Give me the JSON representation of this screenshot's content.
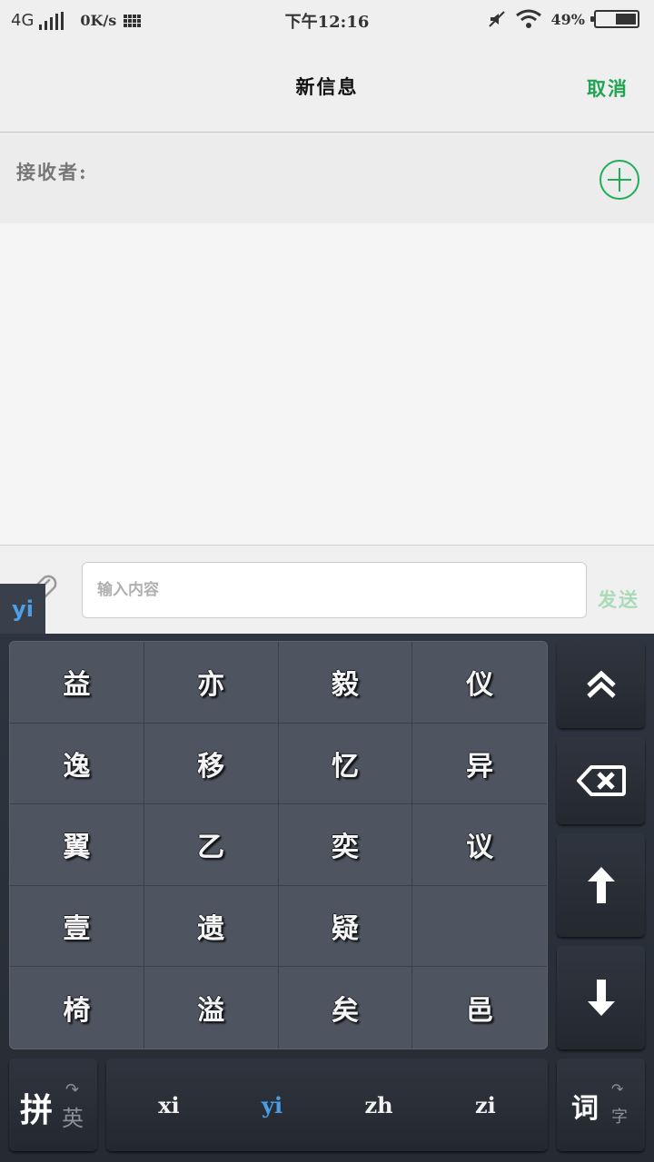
{
  "status_bar": {
    "network": "4G",
    "net_speed": "0K/s",
    "time": "下午12:16",
    "battery": "49%"
  },
  "header": {
    "title": "新信息",
    "cancel_label": "取消"
  },
  "recipient": {
    "label": "接收者:"
  },
  "compose": {
    "placeholder": "输入内容",
    "send_label": "发送"
  },
  "keyboard": {
    "composing_text": "yi",
    "candidates": [
      "益",
      "亦",
      "毅",
      "仪",
      "逸",
      "移",
      "忆",
      "异",
      "翼",
      "乙",
      "奕",
      "议",
      "壹",
      "遗",
      "疑",
      "",
      "椅",
      "溢",
      "矣",
      "邑"
    ],
    "pinyin_options": [
      "xi",
      "yi",
      "zh",
      "zi"
    ],
    "active_pinyin": "yi",
    "lang_key": {
      "main": "拼",
      "sub": "英"
    },
    "word_key": {
      "main": "词",
      "sub": "字"
    }
  }
}
